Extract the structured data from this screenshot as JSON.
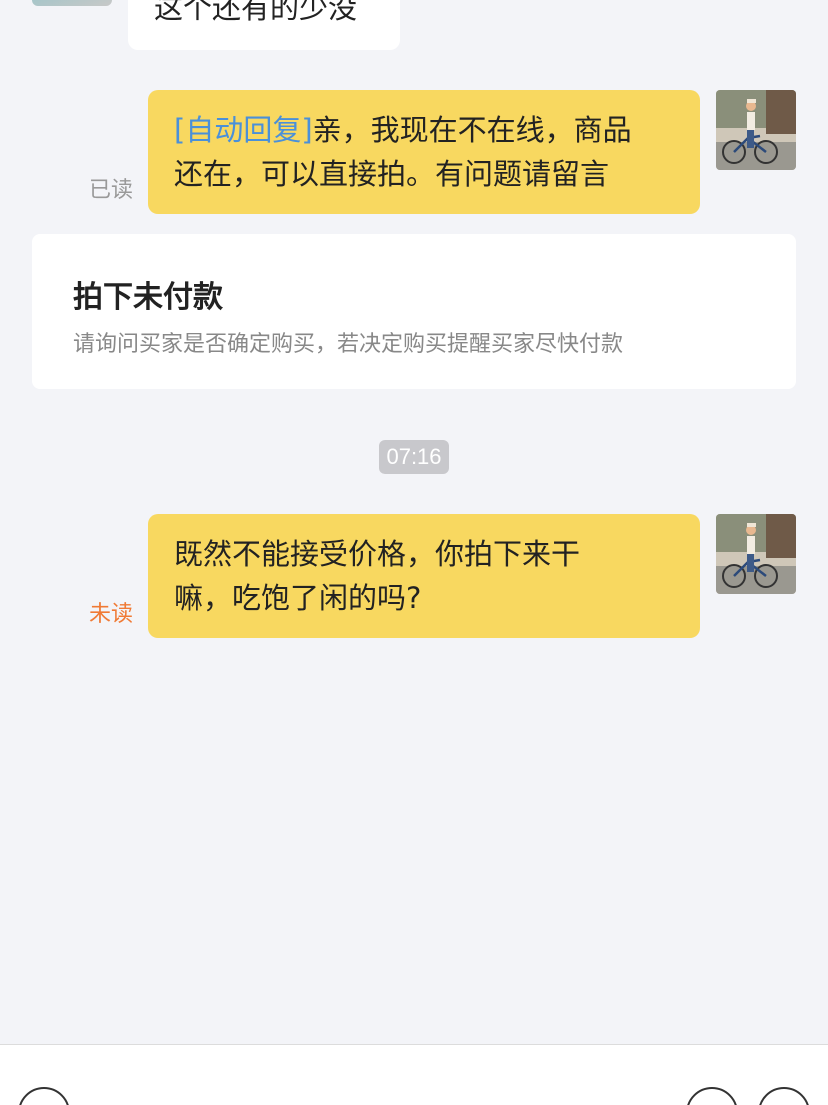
{
  "messages": {
    "incoming_partial": {
      "text": "这个还有的少没"
    },
    "auto_reply": {
      "tag": "[自动回复]",
      "line1_rest": "亲，我现在不在线，商品",
      "line2": "还在，可以直接拍。有问题请留言",
      "status": "已读"
    },
    "reply": {
      "line1": "既然不能接受价格，你拍下来干",
      "line2": "嘛，吃饱了闲的吗?",
      "status": "未读"
    }
  },
  "order_card": {
    "title": "拍下未付款",
    "subtitle": "请询问买家是否确定购买，若决定购买提醒买家尽快付款"
  },
  "timestamp": "07:16",
  "colors": {
    "bubble_out": "#f8d860",
    "auto_tag": "#4a90d9",
    "unread": "#f07a35",
    "read": "#999999"
  },
  "icons": {
    "voice": "voice-icon",
    "emoji": "emoji-icon",
    "add": "plus-icon"
  }
}
